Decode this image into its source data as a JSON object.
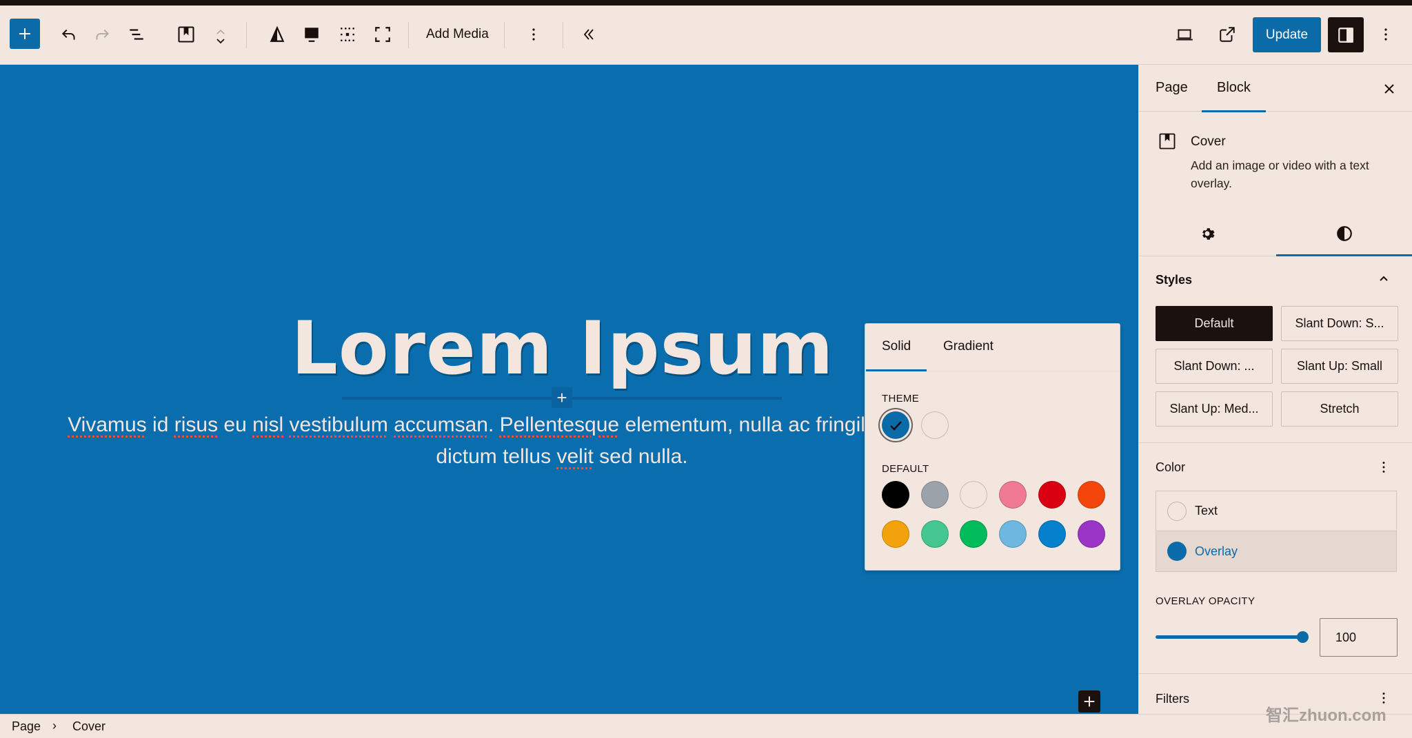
{
  "toolbar": {
    "add_media_label": "Add Media",
    "update_label": "Update",
    "icons": {
      "inserter": "plus-icon",
      "undo": "undo-icon",
      "redo": "redo-icon",
      "list_view": "list-view-icon",
      "block_type": "cover-block-icon",
      "move": "move-up-down-icon",
      "contrast": "triangle-contrast-icon",
      "content_position": "content-position-icon",
      "focal_point": "grid-dots-icon",
      "full_height": "full-height-icon",
      "more": "more-vertical-icon",
      "collapse": "double-chevron-left-icon",
      "preview": "laptop-icon",
      "view_page": "external-link-icon",
      "settings": "sidebar-panel-icon",
      "options": "more-vertical-icon"
    }
  },
  "canvas": {
    "heading": "Lorem Ipsum",
    "paragraph_words": [
      {
        "t": "Vivamus",
        "sp": true
      },
      {
        "t": " id "
      },
      {
        "t": "risus",
        "sp": true
      },
      {
        "t": " eu "
      },
      {
        "t": "nisl",
        "sp": true
      },
      {
        "t": " "
      },
      {
        "t": "vestibulum",
        "sp": true
      },
      {
        "t": " "
      },
      {
        "t": "accumsan",
        "sp": true
      },
      {
        "t": ". "
      },
      {
        "t": "Pellentesque",
        "sp": true
      },
      {
        "t": " elementum, nulla ac fringilla aliquet tortor, vitae dictum tellus "
      },
      {
        "t": "velit",
        "sp": true
      },
      {
        "t": " sed nulla."
      }
    ],
    "background_color": "#0a6dad"
  },
  "color_popover": {
    "tabs": [
      "Solid",
      "Gradient"
    ],
    "active_tab": "Solid",
    "theme_label": "THEME",
    "default_label": "DEFAULT",
    "theme_colors": [
      {
        "name": "Primary",
        "hex": "#0b6aa8",
        "selected": true
      },
      {
        "name": "Base",
        "hex": "#f2e6df",
        "selected": false
      }
    ],
    "default_colors": [
      {
        "name": "Black",
        "hex": "#000000"
      },
      {
        "name": "Cyan bluish gray",
        "hex": "#9ba2a9"
      },
      {
        "name": "White",
        "hex": "#f2e6df"
      },
      {
        "name": "Pale pink",
        "hex": "#f07a94"
      },
      {
        "name": "Vivid red",
        "hex": "#d90012"
      },
      {
        "name": "Luminous vivid orange",
        "hex": "#f4460c"
      },
      {
        "name": "Luminous vivid amber",
        "hex": "#f2a20c"
      },
      {
        "name": "Light green cyan",
        "hex": "#45c690"
      },
      {
        "name": "Vivid green cyan",
        "hex": "#00bb5a"
      },
      {
        "name": "Pale cyan blue",
        "hex": "#6db7e0"
      },
      {
        "name": "Vivid cyan blue",
        "hex": "#0580cc"
      },
      {
        "name": "Vivid purple",
        "hex": "#9a35c8"
      }
    ]
  },
  "sidebar": {
    "tabs": [
      "Page",
      "Block"
    ],
    "active_tab": "Block",
    "block": {
      "title": "Cover",
      "description": "Add an image or video with a text overlay."
    },
    "styles": {
      "title": "Styles",
      "options": [
        "Default",
        "Slant Down: S...",
        "Slant Down: ...",
        "Slant Up: Small",
        "Slant Up: Med...",
        "Stretch"
      ],
      "active": "Default"
    },
    "color": {
      "title": "Color",
      "items": [
        {
          "label": "Text",
          "hex": "#f2e6df"
        },
        {
          "label": "Overlay",
          "hex": "#0b6aa8"
        }
      ],
      "active_item": "Overlay"
    },
    "overlay_opacity": {
      "label": "OVERLAY OPACITY",
      "value": "100",
      "fraction": 1.0
    },
    "filters": {
      "title": "Filters"
    }
  },
  "footer": {
    "breadcrumb": [
      "Page",
      "Cover"
    ]
  },
  "watermark": "智汇zhuon.com",
  "colors": {
    "accent": "#0b6aa8",
    "background": "#f2e6df",
    "dark": "#1b1210"
  }
}
